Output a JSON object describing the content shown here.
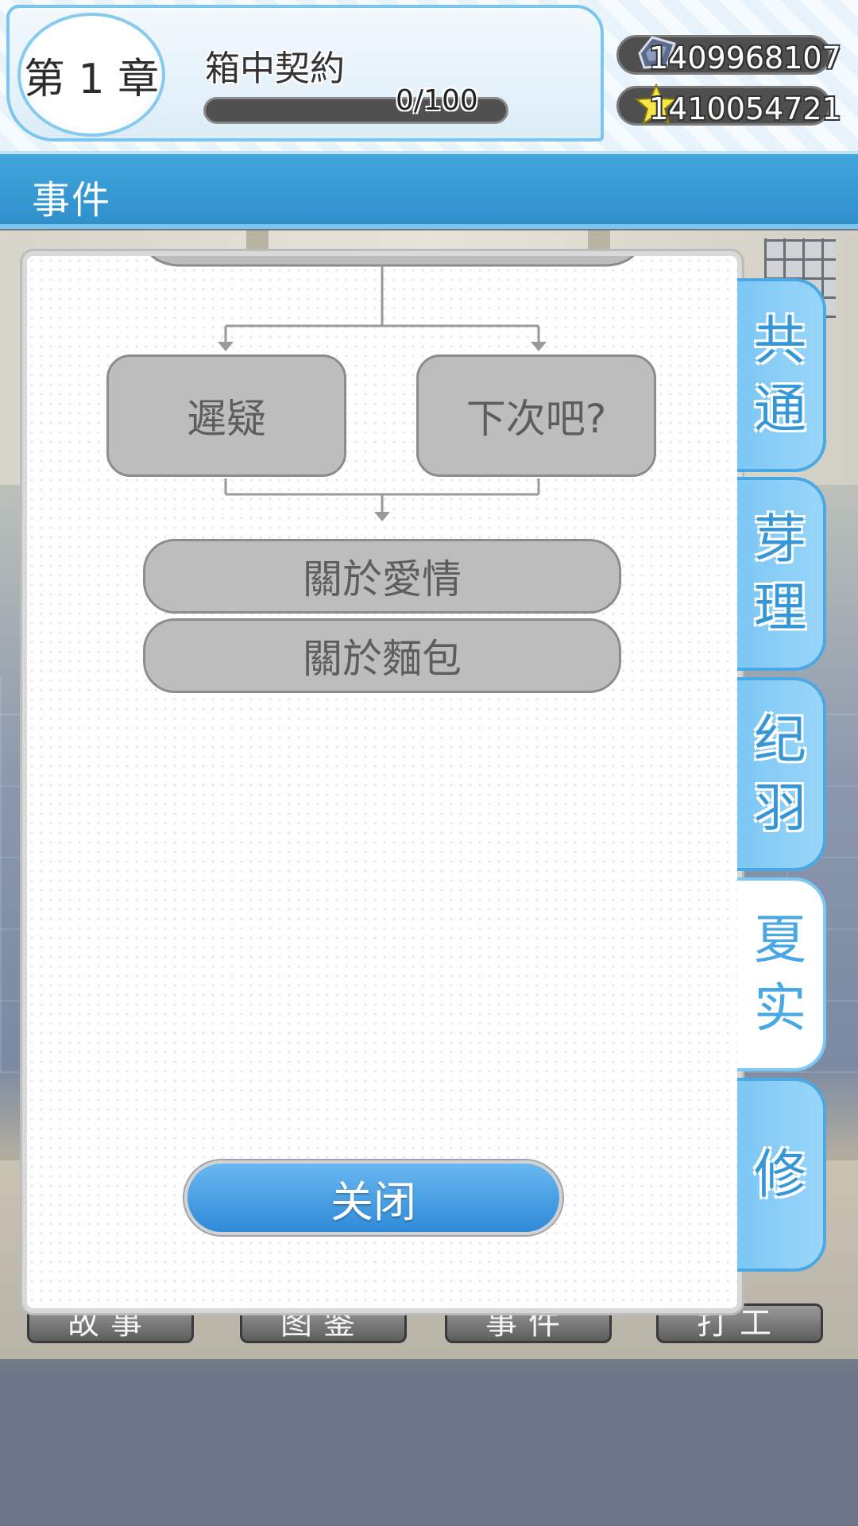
{
  "header": {
    "chapter_label": "第 1 章",
    "chapter_title": "箱中契約",
    "progress": {
      "current": 0,
      "max": 100,
      "text": "0/100"
    },
    "currencies": [
      {
        "icon": "gem-icon",
        "value": "1409968107"
      },
      {
        "icon": "star-icon",
        "value": "1410054721"
      }
    ]
  },
  "section": {
    "title": "事件"
  },
  "flowchart": {
    "choices": [
      "遲疑",
      "下次吧?"
    ],
    "events": [
      "關於愛情",
      "關於麵包"
    ]
  },
  "dialog": {
    "close_label": "关闭"
  },
  "tabs": [
    {
      "label": "共通",
      "chars": [
        "共",
        "通"
      ],
      "active": false
    },
    {
      "label": "芽理",
      "chars": [
        "芽",
        "理"
      ],
      "active": false
    },
    {
      "label": "纪羽",
      "chars": [
        "纪",
        "羽"
      ],
      "active": false
    },
    {
      "label": "夏实",
      "chars": [
        "夏",
        "实"
      ],
      "active": true
    },
    {
      "label": "修",
      "chars": [
        "修"
      ],
      "active": false
    }
  ],
  "bottom_nav": [
    "故事",
    "图鉴",
    "事件",
    "打工"
  ],
  "colors": {
    "accent": "#3796d6",
    "node_fill": "#bdbdbd",
    "close_button": "#2f8ad8"
  }
}
